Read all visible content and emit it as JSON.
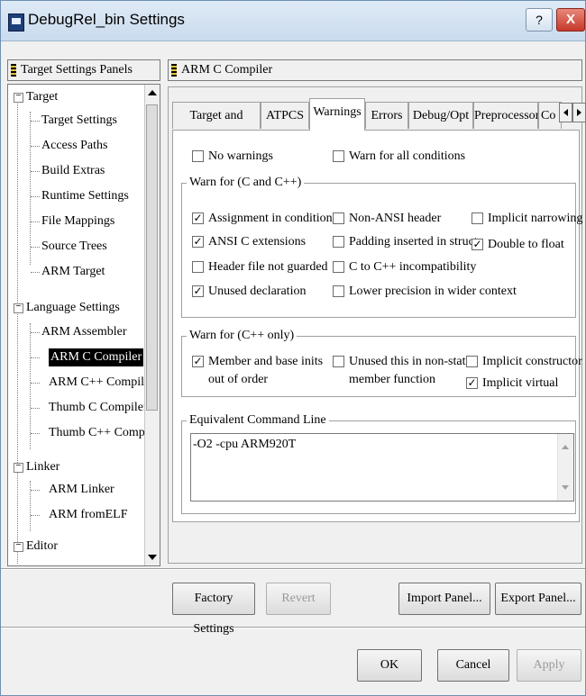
{
  "window": {
    "title": "DebugRel_bin Settings",
    "help_glyph": "?",
    "close_glyph": "X"
  },
  "left_panel": {
    "header": "Target Settings Panels",
    "tree": [
      {
        "label": "Target",
        "level": 0,
        "expander": "−"
      },
      {
        "label": "Target Settings",
        "level": 1
      },
      {
        "label": "Access Paths",
        "level": 1
      },
      {
        "label": "Build Extras",
        "level": 1
      },
      {
        "label": "Runtime Settings",
        "level": 1
      },
      {
        "label": "File Mappings",
        "level": 1
      },
      {
        "label": "Source Trees",
        "level": 1
      },
      {
        "label": "ARM Target",
        "level": 1
      },
      {
        "label": "Language Settings",
        "level": 0,
        "expander": "−"
      },
      {
        "label": "ARM Assembler",
        "level": 1
      },
      {
        "label": "ARM C Compiler",
        "level": 1,
        "selected": true
      },
      {
        "label": "ARM C++ Compiler",
        "level": 1
      },
      {
        "label": "Thumb C Compiler",
        "level": 1
      },
      {
        "label": "Thumb C++ Compi...",
        "level": 1
      },
      {
        "label": "Linker",
        "level": 0,
        "expander": "−"
      },
      {
        "label": "ARM Linker",
        "level": 1
      },
      {
        "label": "ARM fromELF",
        "level": 1
      },
      {
        "label": "Editor",
        "level": 0,
        "expander": "−"
      }
    ]
  },
  "right_panel": {
    "header": "ARM C Compiler",
    "tabs": [
      "Target and Source",
      "ATPCS",
      "Warnings",
      "Errors",
      "Debug/Opt",
      "Preprocessor",
      "Co"
    ],
    "active_tab": "Warnings",
    "top_options": [
      {
        "label": "No warnings",
        "checked": false
      },
      {
        "label": "Warn for all conditions",
        "checked": false
      }
    ],
    "group_c": {
      "title": "Warn for (C and C++)",
      "options": [
        {
          "label": "Assignment in condition",
          "checked": true
        },
        {
          "label": "ANSI C extensions",
          "checked": true
        },
        {
          "label": "Header file not guarded",
          "checked": false
        },
        {
          "label": "Unused declaration",
          "checked": true
        },
        {
          "label": "Non-ANSI header",
          "checked": false
        },
        {
          "label": "Padding inserted in struct",
          "checked": false
        },
        {
          "label": "C to C++ incompatibility",
          "checked": false
        },
        {
          "label": "Lower precision in wider context",
          "checked": false
        },
        {
          "label": "Implicit narrowing",
          "checked": false
        },
        {
          "label": "Double to float",
          "checked": true
        }
      ]
    },
    "group_cpp": {
      "title": "Warn for (C++ only)",
      "options": [
        {
          "label_line1": "Member and base inits",
          "label_line2": "out of order",
          "checked": true
        },
        {
          "label_line1": "Unused this in non-static",
          "label_line2": "member function",
          "checked": false
        },
        {
          "label": "Implicit constructor",
          "checked": false
        },
        {
          "label": "Implicit virtual",
          "checked": true
        }
      ]
    },
    "command_line": {
      "title": "Equivalent Command Line",
      "value": "-O2 -cpu ARM920T"
    }
  },
  "buttons": {
    "factory_settings": "Factory Settings",
    "revert": "Revert",
    "import_panel": "Import Panel...",
    "export_panel": "Export Panel...",
    "ok": "OK",
    "cancel": "Cancel",
    "apply": "Apply"
  },
  "glyphs": {
    "check": "✓"
  }
}
